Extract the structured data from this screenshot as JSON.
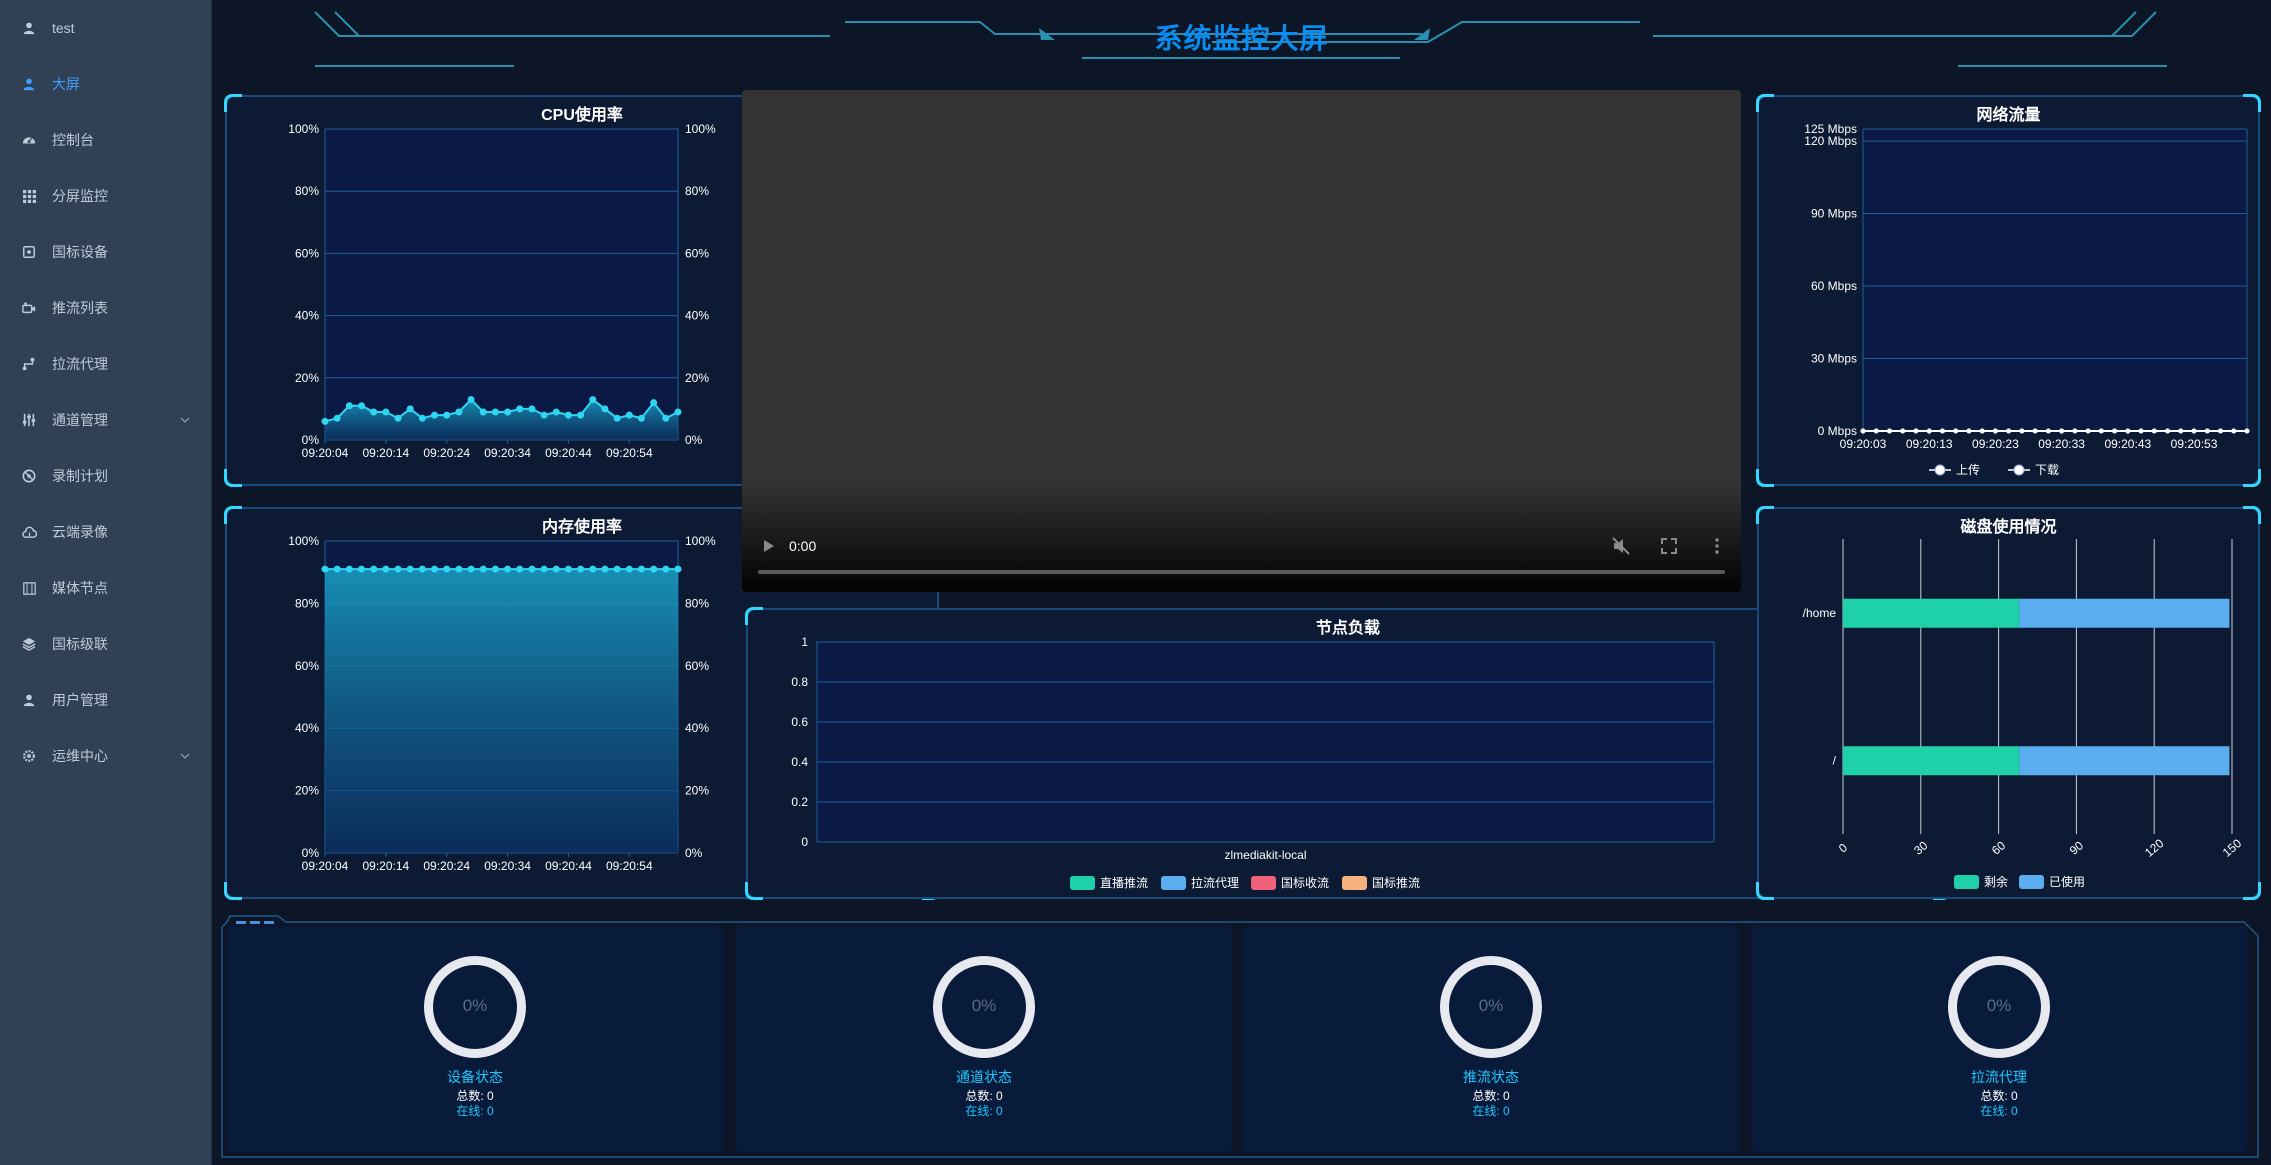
{
  "colors": {
    "sidebar_bg": "#304156",
    "main_bg": "#0d1626",
    "accent": "#409eff",
    "title": "#0a8cf0",
    "cyan": "#35d7ff",
    "panel_bg": "#0c1a33"
  },
  "sidebar": {
    "items": [
      {
        "label": "test",
        "icon": "user-icon",
        "active": false,
        "expandable": false
      },
      {
        "label": "大屏",
        "icon": "user-icon",
        "active": true,
        "expandable": false
      },
      {
        "label": "控制台",
        "icon": "dashboard-icon",
        "active": false,
        "expandable": false
      },
      {
        "label": "分屏监控",
        "icon": "grid-icon",
        "active": false,
        "expandable": false
      },
      {
        "label": "国标设备",
        "icon": "device-icon",
        "active": false,
        "expandable": false
      },
      {
        "label": "推流列表",
        "icon": "camera-icon",
        "active": false,
        "expandable": false
      },
      {
        "label": "拉流代理",
        "icon": "route-icon",
        "active": false,
        "expandable": false
      },
      {
        "label": "通道管理",
        "icon": "sliders-icon",
        "active": false,
        "expandable": true
      },
      {
        "label": "录制计划",
        "icon": "record-icon",
        "active": false,
        "expandable": false
      },
      {
        "label": "云端录像",
        "icon": "cloud-icon",
        "active": false,
        "expandable": false
      },
      {
        "label": "媒体节点",
        "icon": "server-icon",
        "active": false,
        "expandable": false
      },
      {
        "label": "国标级联",
        "icon": "layers-icon",
        "active": false,
        "expandable": false
      },
      {
        "label": "用户管理",
        "icon": "user-icon",
        "active": false,
        "expandable": false
      },
      {
        "label": "运维中心",
        "icon": "gear-icon",
        "active": false,
        "expandable": true
      }
    ]
  },
  "header": {
    "title": "系统监控大屏"
  },
  "video": {
    "time": "0:00",
    "progress": 0,
    "muted": true
  },
  "chart_data": [
    {
      "id": "cpu",
      "type": "area",
      "title": "CPU使用率",
      "ylim": [
        0,
        100
      ],
      "yticks": [
        0,
        20,
        40,
        60,
        80,
        100
      ],
      "ytick_suffix": "%",
      "x_ticks": [
        "09:20:04",
        "09:20:14",
        "09:20:24",
        "09:20:34",
        "09:20:44",
        "09:20:54"
      ],
      "x_start": "09:20:04",
      "x_end": "09:21:02",
      "x_step_seconds": 2,
      "values": [
        6,
        7,
        11,
        11,
        9,
        9,
        7,
        10,
        7,
        8,
        8,
        9,
        13,
        9,
        9,
        9,
        10,
        10,
        8,
        9,
        8,
        8,
        13,
        10,
        7,
        8,
        7,
        12,
        7,
        9
      ]
    },
    {
      "id": "memory",
      "type": "area",
      "title": "内存使用率",
      "ylim": [
        0,
        100
      ],
      "yticks": [
        0,
        20,
        40,
        60,
        80,
        100
      ],
      "ytick_suffix": "%",
      "x_ticks": [
        "09:20:04",
        "09:20:14",
        "09:20:24",
        "09:20:34",
        "09:20:44",
        "09:20:54"
      ],
      "x_start": "09:20:04",
      "x_end": "09:21:02",
      "x_step_seconds": 2,
      "values": [
        91,
        91,
        91,
        91,
        91,
        91,
        91,
        91,
        91,
        91,
        91,
        91,
        91,
        91,
        91,
        91,
        91,
        91,
        91,
        91,
        91,
        91,
        91,
        91,
        91,
        91,
        91,
        91,
        91,
        91
      ]
    },
    {
      "id": "network",
      "type": "line",
      "title": "网络流量",
      "ylim": [
        0,
        125
      ],
      "yticks": [
        0,
        30,
        60,
        90,
        120,
        125
      ],
      "ytick_suffix": " Mbps",
      "x_ticks": [
        "09:20:03",
        "09:20:13",
        "09:20:23",
        "09:20:33",
        "09:20:43",
        "09:20:53"
      ],
      "x_start": "09:20:03",
      "x_end": "09:21:01",
      "x_step_seconds": 2,
      "series": [
        {
          "name": "上传",
          "values": [
            0,
            0,
            0,
            0,
            0,
            0,
            0,
            0,
            0,
            0,
            0,
            0,
            0,
            0,
            0,
            0,
            0,
            0,
            0,
            0,
            0,
            0,
            0,
            0,
            0,
            0,
            0,
            0,
            0,
            0
          ]
        },
        {
          "name": "下载",
          "values": [
            0,
            0,
            0,
            0,
            0,
            0,
            0,
            0,
            0,
            0,
            0,
            0,
            0,
            0,
            0,
            0,
            0,
            0,
            0,
            0,
            0,
            0,
            0,
            0,
            0,
            0,
            0,
            0,
            0,
            0
          ]
        }
      ]
    },
    {
      "id": "node-load",
      "type": "bar",
      "title": "节点负载",
      "categories": [
        "zlmediakit-local"
      ],
      "ylim": [
        0,
        1
      ],
      "yticks": [
        0,
        0.2,
        0.4,
        0.6,
        0.8,
        1
      ],
      "series": [
        {
          "name": "直播推流",
          "color": "#1fd1a8",
          "values": [
            0
          ]
        },
        {
          "name": "拉流代理",
          "color": "#5aaef0",
          "values": [
            0
          ]
        },
        {
          "name": "国标收流",
          "color": "#f0627a",
          "values": [
            0
          ]
        },
        {
          "name": "国标推流",
          "color": "#f7b27f",
          "values": [
            0
          ]
        }
      ]
    },
    {
      "id": "disk",
      "type": "bar",
      "orientation": "horizontal",
      "stacked": true,
      "title": "磁盘使用情况",
      "categories": [
        "/home",
        "/"
      ],
      "xlim": [
        0,
        150
      ],
      "xticks": [
        0,
        30,
        60,
        90,
        120,
        150
      ],
      "series": [
        {
          "name": "剩余",
          "color": "#1fd1a8",
          "values": [
            68,
            68
          ]
        },
        {
          "name": "已使用",
          "color": "#5aaef0",
          "values": [
            81,
            81
          ]
        }
      ]
    }
  ],
  "stats": [
    {
      "percent": "0%",
      "name": "设备状态",
      "total": "总数: 0",
      "online": "在线: 0"
    },
    {
      "percent": "0%",
      "name": "通道状态",
      "total": "总数: 0",
      "online": "在线: 0"
    },
    {
      "percent": "0%",
      "name": "推流状态",
      "total": "总数: 0",
      "online": "在线: 0"
    },
    {
      "percent": "0%",
      "name": "拉流代理",
      "total": "总数: 0",
      "online": "在线: 0"
    }
  ]
}
